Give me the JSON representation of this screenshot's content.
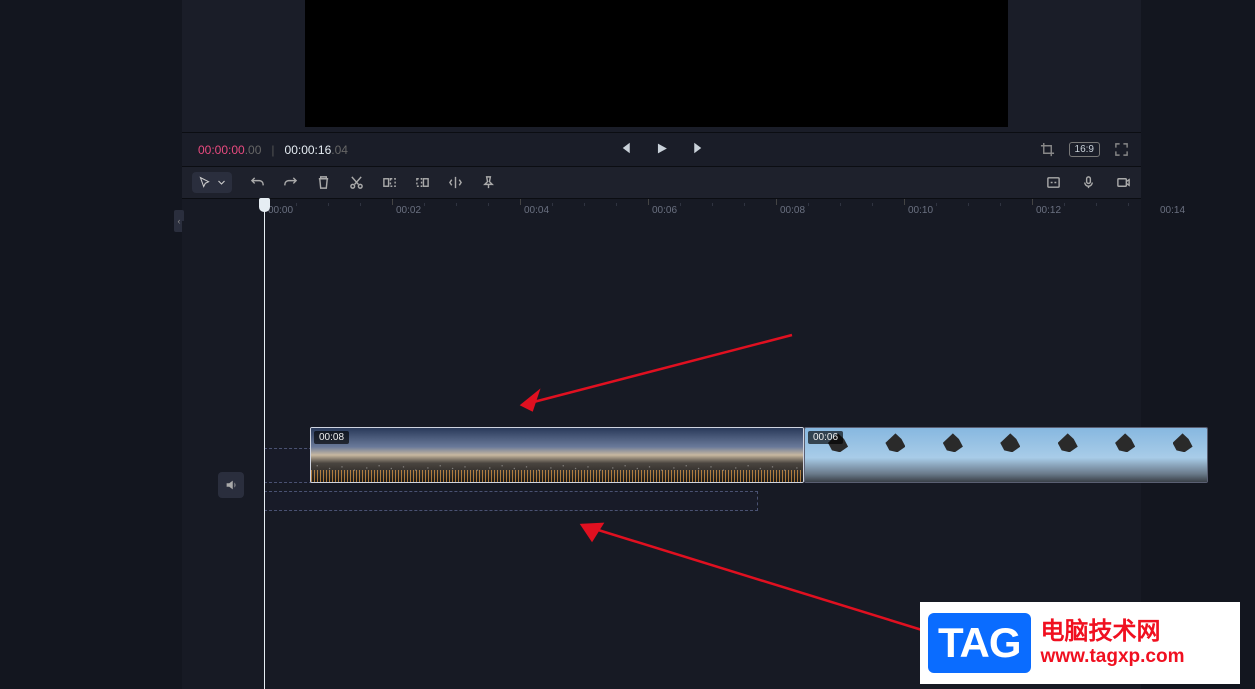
{
  "playback": {
    "current_time": "00:00:00",
    "current_frames": ".00",
    "total_time": "00:00:16",
    "total_frames": ".04",
    "aspect_ratio": "16:9"
  },
  "ruler": {
    "ticks": [
      "00:00",
      "00:02",
      "00:04",
      "00:06",
      "00:08",
      "00:10",
      "00:12",
      "00:14"
    ]
  },
  "clips": [
    {
      "duration_label": "00:08"
    },
    {
      "duration_label": "00:06"
    }
  ],
  "icons": {
    "cursor": "cursor",
    "chevron_down": "chevron-down",
    "undo": "undo",
    "redo": "redo",
    "delete": "delete",
    "cut": "cut",
    "split_left": "split-left",
    "split_right": "split-right",
    "mirror": "mirror",
    "pin": "pin",
    "auto_caption": "auto-caption",
    "mic": "microphone",
    "record": "record-screen",
    "crop": "crop",
    "fullscreen": "fullscreen",
    "prev": "previous-frame",
    "play": "play",
    "next": "next-frame",
    "speaker": "speaker",
    "collapse": "collapse"
  },
  "watermark": {
    "badge": "TAG",
    "line1": "电脑技术网",
    "line2": "www.tagxp.com"
  }
}
